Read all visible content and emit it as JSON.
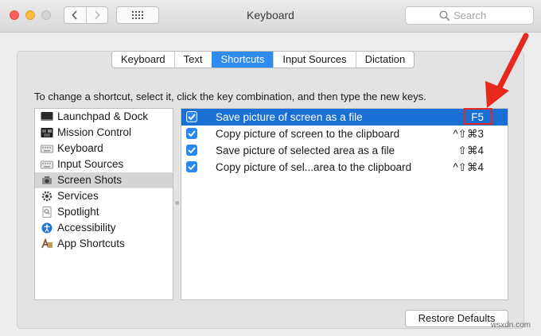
{
  "window": {
    "title": "Keyboard"
  },
  "search": {
    "placeholder": "Search"
  },
  "tabs": [
    {
      "label": "Keyboard",
      "active": false
    },
    {
      "label": "Text",
      "active": false
    },
    {
      "label": "Shortcuts",
      "active": true
    },
    {
      "label": "Input Sources",
      "active": false
    },
    {
      "label": "Dictation",
      "active": false
    }
  ],
  "instructions": "To change a shortcut, select it, click the key combination, and then type the new keys.",
  "categories": [
    {
      "label": "Launchpad & Dock",
      "icon": "launchpad-icon"
    },
    {
      "label": "Mission Control",
      "icon": "mission-control-icon"
    },
    {
      "label": "Keyboard",
      "icon": "keyboard-icon"
    },
    {
      "label": "Input Sources",
      "icon": "input-sources-icon"
    },
    {
      "label": "Screen Shots",
      "icon": "screenshot-icon",
      "selected": true
    },
    {
      "label": "Services",
      "icon": "gear-icon"
    },
    {
      "label": "Spotlight",
      "icon": "spotlight-icon"
    },
    {
      "label": "Accessibility",
      "icon": "accessibility-icon"
    },
    {
      "label": "App Shortcuts",
      "icon": "app-shortcuts-icon"
    }
  ],
  "shortcuts": [
    {
      "label": "Save picture of screen as a file",
      "key": "F5",
      "checked": true,
      "selected": true
    },
    {
      "label": "Copy picture of screen to the clipboard",
      "key": "^⇧⌘3",
      "checked": true
    },
    {
      "label": "Save picture of selected area as a file",
      "key": "⇧⌘4",
      "checked": true
    },
    {
      "label": "Copy picture of sel...area to the clipboard",
      "key": "^⇧⌘4",
      "checked": true
    }
  ],
  "restore_label": "Restore Defaults",
  "watermark": "wsxdn.com",
  "colors": {
    "accent": "#1a6fd4",
    "tab_active": "#2d8cf0",
    "annotation": "#e8271d"
  }
}
